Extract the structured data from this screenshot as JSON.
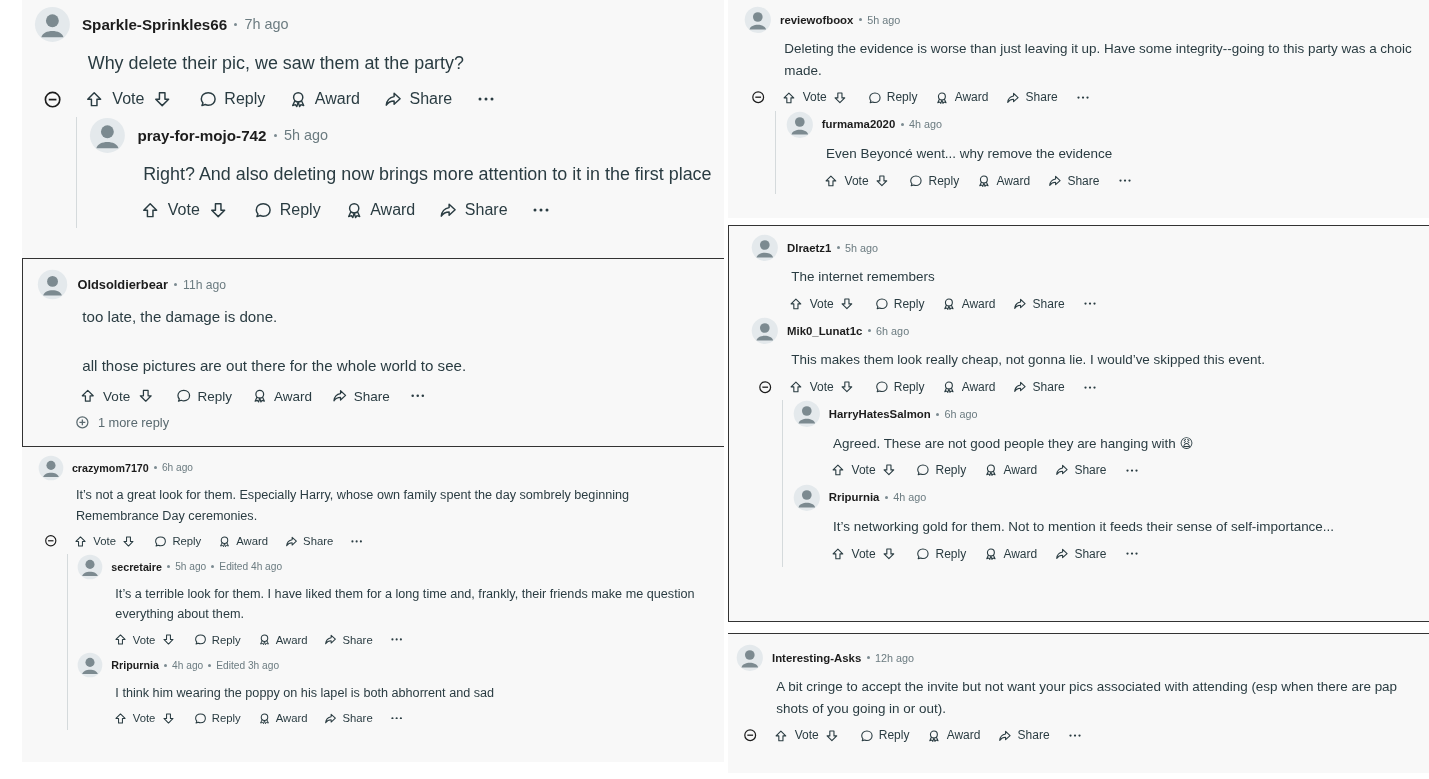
{
  "columns": [
    {
      "panels": [
        {
          "comments": [
            {
              "user": "Sparkle-Sprinkles66",
              "time": "7h ago",
              "body": "Why delete their pic, we saw them at the party?",
              "expanded": true,
              "actions": {
                "vote": "Vote",
                "reply": "Reply",
                "award": "Award",
                "share": "Share"
              },
              "children": [
                {
                  "user": "pray-for-mojo-742",
                  "time": "5h ago",
                  "body": "Right? And also deleting now brings more attention to it in the first place",
                  "expanded": false,
                  "actions": {
                    "vote": "Vote",
                    "reply": "Reply",
                    "award": "Award",
                    "share": "Share"
                  }
                }
              ]
            }
          ]
        },
        {
          "comments": [
            {
              "user": "Oldsoldierbear",
              "time": "11h ago",
              "body": "too late, the damage is done.\n\nall those pictures are out there for the whole world to see.",
              "expanded": false,
              "actions": {
                "vote": "Vote",
                "reply": "Reply",
                "award": "Award",
                "share": "Share"
              },
              "more_replies": "1 more reply"
            }
          ]
        },
        {
          "comments": [
            {
              "user": "crazymom7170",
              "time": "6h ago",
              "body": "It’s not a great look for them. Especially Harry, whose own family spent the day sombrely beginning\nRemembrance Day ceremonies.",
              "expanded": true,
              "actions": {
                "vote": "Vote",
                "reply": "Reply",
                "award": "Award",
                "share": "Share"
              },
              "children": [
                {
                  "user": "secretaire",
                  "time": "5h ago",
                  "edited": "Edited 4h ago",
                  "body": "It’s a terrible look for them. I have liked them for a long time and, frankly, their friends make me question\neverything about them.",
                  "expanded": false,
                  "actions": {
                    "vote": "Vote",
                    "reply": "Reply",
                    "award": "Award",
                    "share": "Share"
                  }
                },
                {
                  "user": "Rripurnia",
                  "time": "4h ago",
                  "edited": "Edited 3h ago",
                  "body": "I think him wearing the poppy on his lapel is both abhorrent and sad",
                  "expanded": false,
                  "actions": {
                    "vote": "Vote",
                    "reply": "Reply",
                    "award": "Award",
                    "share": "Share"
                  }
                }
              ]
            }
          ]
        }
      ]
    },
    {
      "panels": [
        {
          "comments": [
            {
              "user": "reviewofboox",
              "time": "5h ago",
              "body": "Deleting the evidence is worse than just leaving it up. Have some integrity--going to this party was a choic\nmade.",
              "expanded": true,
              "actions": {
                "vote": "Vote",
                "reply": "Reply",
                "award": "Award",
                "share": "Share"
              },
              "children": [
                {
                  "user": "furmama2020",
                  "time": "4h ago",
                  "body": "Even Beyoncé went... why remove the evidence",
                  "expanded": false,
                  "actions": {
                    "vote": "Vote",
                    "reply": "Reply",
                    "award": "Award",
                    "share": "Share"
                  }
                }
              ]
            }
          ]
        },
        {
          "comments": [
            {
              "user": "Dlraetz1",
              "time": "5h ago",
              "body": "The internet remembers",
              "expanded": false,
              "actions": {
                "vote": "Vote",
                "reply": "Reply",
                "award": "Award",
                "share": "Share"
              }
            },
            {
              "user": "Mik0_Lunat1c",
              "time": "6h ago",
              "body": "This makes them look really cheap, not gonna lie. I would’ve skipped this event.",
              "expanded": true,
              "actions": {
                "vote": "Vote",
                "reply": "Reply",
                "award": "Award",
                "share": "Share"
              },
              "children": [
                {
                  "user": "HarryHatesSalmon",
                  "time": "6h ago",
                  "body": "Agreed. These are not good people they are hanging with 😩",
                  "expanded": false,
                  "actions": {
                    "vote": "Vote",
                    "reply": "Reply",
                    "award": "Award",
                    "share": "Share"
                  }
                },
                {
                  "user": "Rripurnia",
                  "time": "4h ago",
                  "body": "It’s networking gold for them. Not to mention it feeds their sense of self-importance...",
                  "expanded": false,
                  "actions": {
                    "vote": "Vote",
                    "reply": "Reply",
                    "award": "Award",
                    "share": "Share"
                  }
                }
              ]
            }
          ]
        },
        {
          "comments": [
            {
              "user": "Interesting-Asks",
              "time": "12h ago",
              "body": "A bit cringe to accept the invite but not want your pics associated with attending (esp when there are pap\nshots of you going in or out).",
              "expanded": true,
              "actions": {
                "vote": "Vote",
                "reply": "Reply",
                "award": "Award",
                "share": "Share"
              }
            }
          ]
        }
      ]
    }
  ]
}
